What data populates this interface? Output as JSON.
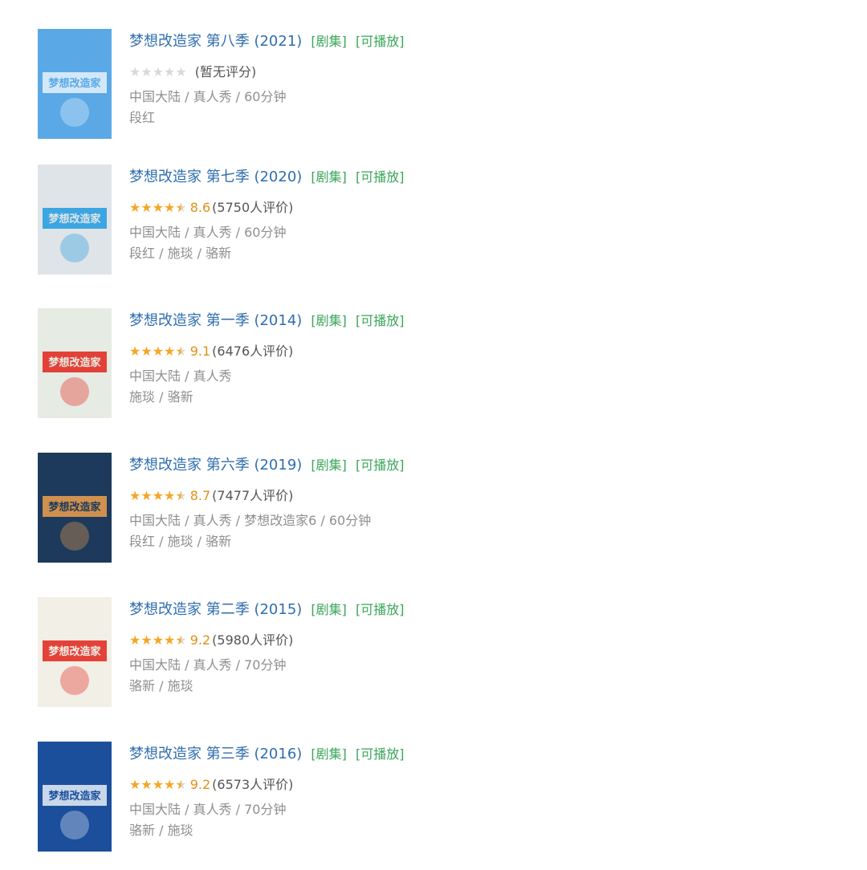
{
  "items": [
    {
      "title": "梦想改造家 第八季 (2021)",
      "tag1": "[剧集]",
      "tag2": "[可播放]",
      "rating": 0,
      "score": "",
      "votes": "(暂无评分)",
      "meta": "中国大陆 / 真人秀 / 60分钟",
      "cast": "段红",
      "poster": {
        "bg": "#5aa9e6",
        "accent": "#e8f3fb",
        "text": "梦想改造家"
      }
    },
    {
      "title": "梦想改造家 第七季 (2020)",
      "tag1": "[剧集]",
      "tag2": "[可播放]",
      "rating": 4.5,
      "score": "8.6",
      "votes": "(5750人评价)",
      "meta": "中国大陆 / 真人秀 / 60分钟",
      "cast": "段红 / 施琰 / 骆新",
      "poster": {
        "bg": "#dfe4e8",
        "accent": "#1f9be0",
        "text": "梦想改造家"
      }
    },
    {
      "title": "梦想改造家 第一季 (2014)",
      "tag1": "[剧集]",
      "tag2": "[可播放]",
      "rating": 4.5,
      "score": "9.1",
      "votes": "(6476人评价)",
      "meta": "中国大陆 / 真人秀",
      "cast": "施琰 / 骆新",
      "poster": {
        "bg": "#e6ebe3",
        "accent": "#e2231a",
        "text": "梦想改造家"
      }
    },
    {
      "title": "梦想改造家 第六季 (2019)",
      "tag1": "[剧集]",
      "tag2": "[可播放]",
      "rating": 4.5,
      "score": "8.7",
      "votes": "(7477人评价)",
      "meta": "中国大陆 / 真人秀 / 梦想改造家6 / 60分钟",
      "cast": "段红 / 施琰 / 骆新",
      "poster": {
        "bg": "#1d3a5c",
        "accent": "#f0a04b",
        "text": "梦想改造家"
      }
    },
    {
      "title": "梦想改造家 第二季 (2015)",
      "tag1": "[剧集]",
      "tag2": "[可播放]",
      "rating": 4.5,
      "score": "9.2",
      "votes": "(5980人评价)",
      "meta": "中国大陆 / 真人秀 / 70分钟",
      "cast": "骆新 / 施琰",
      "poster": {
        "bg": "#f1efe6",
        "accent": "#e2231a",
        "text": "梦想改造家"
      }
    },
    {
      "title": "梦想改造家 第三季 (2016)",
      "tag1": "[剧集]",
      "tag2": "[可播放]",
      "rating": 4.5,
      "score": "9.2",
      "votes": "(6573人评价)",
      "meta": "中国大陆 / 真人秀 / 70分钟",
      "cast": "骆新 / 施琰",
      "poster": {
        "bg": "#1b4f9c",
        "accent": "#e8eef8",
        "text": "梦想改造家"
      }
    }
  ]
}
